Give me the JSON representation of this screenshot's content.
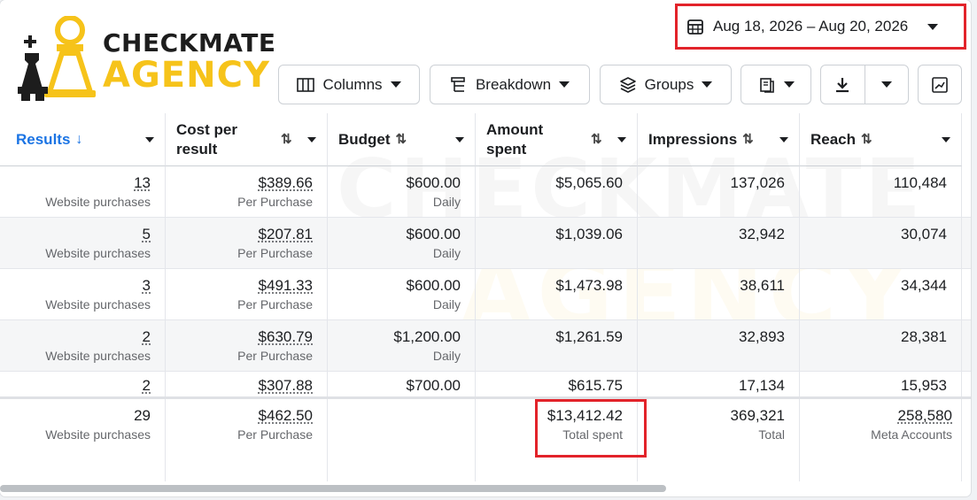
{
  "brand": {
    "line1": "CHECKMATE",
    "line2": "AGENCY",
    "accent": "#f6c31a",
    "dark": "#1d1d1d"
  },
  "date_range": {
    "label": "Aug 18, 2026 – Aug 20, 2026",
    "icon": "calendar-icon"
  },
  "toolbar": {
    "columns_label": "Columns",
    "breakdown_label": "Breakdown",
    "groups_label": "Groups"
  },
  "columns": {
    "results": "Results",
    "cost_per_result": "Cost per result",
    "budget": "Budget",
    "amount_spent": "Amount spent",
    "impressions": "Impressions",
    "reach": "Reach"
  },
  "rows": [
    {
      "results": "13",
      "results_sub": "Website purchases",
      "cpr": "$389.66",
      "cpr_sub": "Per Purchase",
      "budget": "$600.00",
      "budget_sub": "Daily",
      "spent": "$5,065.60",
      "impressions": "137,026",
      "reach": "110,484"
    },
    {
      "results": "5",
      "results_sub": "Website purchases",
      "cpr": "$207.81",
      "cpr_sub": "Per Purchase",
      "budget": "$600.00",
      "budget_sub": "Daily",
      "spent": "$1,039.06",
      "impressions": "32,942",
      "reach": "30,074"
    },
    {
      "results": "3",
      "results_sub": "Website purchases",
      "cpr": "$491.33",
      "cpr_sub": "Per Purchase",
      "budget": "$600.00",
      "budget_sub": "Daily",
      "spent": "$1,473.98",
      "impressions": "38,611",
      "reach": "34,344"
    },
    {
      "results": "2",
      "results_sub": "Website purchases",
      "cpr": "$630.79",
      "cpr_sub": "Per Purchase",
      "budget": "$1,200.00",
      "budget_sub": "Daily",
      "spent": "$1,261.59",
      "impressions": "32,893",
      "reach": "28,381"
    },
    {
      "results": "2",
      "results_sub": "",
      "cpr": "$307.88",
      "cpr_sub": "",
      "budget": "$700.00",
      "budget_sub": "",
      "spent": "$615.75",
      "impressions": "17,134",
      "reach": "15,953"
    }
  ],
  "totals": {
    "results": "29",
    "results_sub": "Website purchases",
    "cpr": "$462.50",
    "cpr_sub": "Per Purchase",
    "spent": "$13,412.42",
    "spent_sub": "Total spent",
    "impressions": "369,321",
    "impressions_sub": "Total",
    "reach": "258,580",
    "reach_sub": "Meta Accounts"
  },
  "highlight_color": "#e2232a",
  "link_color": "#1b74e4"
}
